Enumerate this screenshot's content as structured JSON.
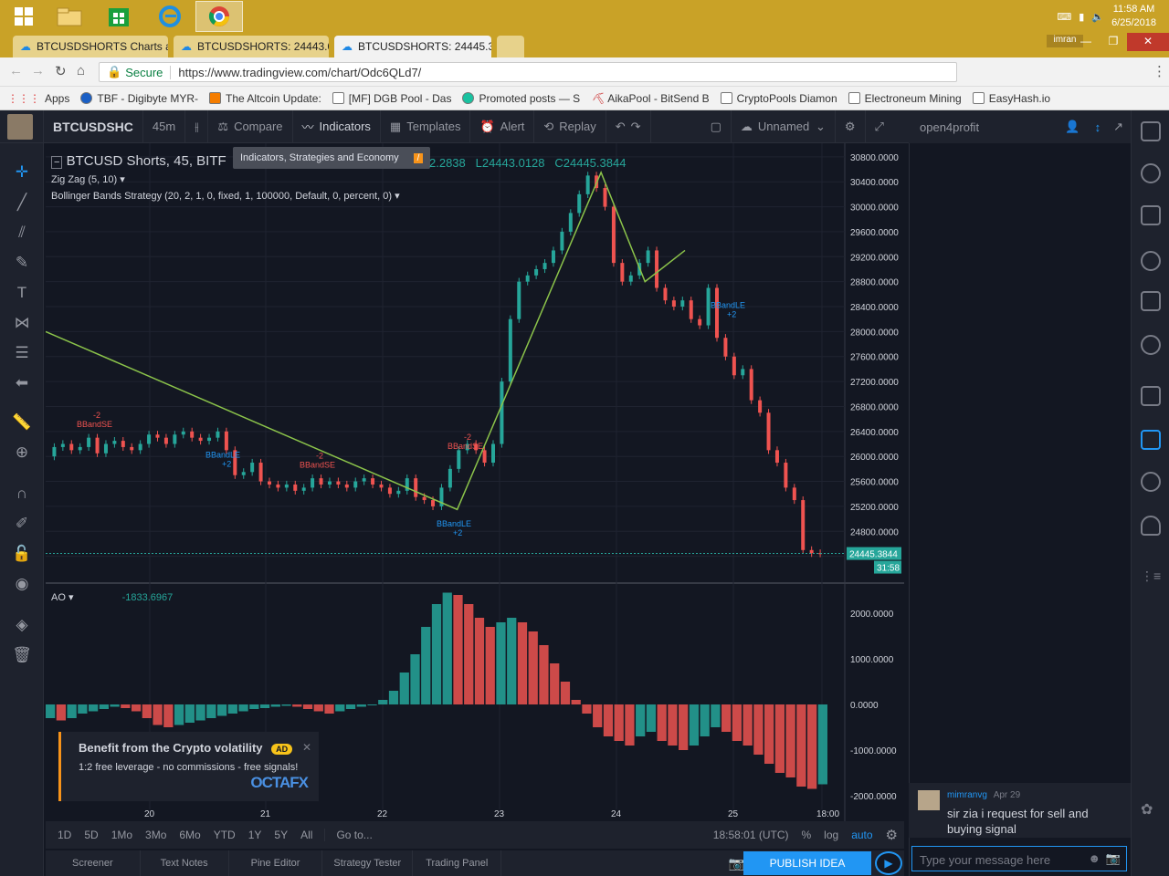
{
  "os": {
    "clock_time": "11:58 AM",
    "clock_date": "6/25/2018",
    "user": "imran"
  },
  "tabs": [
    {
      "label": "BTCUSDSHORTS Charts a",
      "close": "×"
    },
    {
      "label": "BTCUSDSHORTS: 24443.0",
      "close": "×"
    },
    {
      "label": "BTCUSDSHORTS: 24445.3",
      "close": "×"
    }
  ],
  "addressbar": {
    "secure_label": "Secure",
    "url": "https://www.tradingview.com/chart/Odc6QLd7/"
  },
  "bookmarks": [
    "Apps",
    "TBF - Digibyte MYR-",
    "The Altcoin Update:",
    "[MF] DGB Pool - Das",
    "Promoted posts — S",
    "AikaPool - BitSend B",
    "CryptoPools Diamon",
    "Electroneum Mining",
    "EasyHash.io"
  ],
  "toolbar": {
    "symbol": "BTCUSDSHC",
    "interval": "45m",
    "compare": "Compare",
    "indicators": "Indicators",
    "templates": "Templates",
    "alert": "Alert",
    "replay": "Replay",
    "layout_name": "Unnamed"
  },
  "tooltip": {
    "text": "Indicators, Strategies and Economy",
    "shortcut": "/"
  },
  "legend": {
    "title": "BTCUSD Shorts, 45, BITF",
    "ohlc_h": "2.2838",
    "ohlc_l": "L24443.0128",
    "ohlc_c": "C24445.3844",
    "indicator1": "Zig Zag (5, 10)",
    "indicator2": "Bollinger Bands Strategy (20, 2, 1, 0, fixed, 1, 100000, Default, 0, percent, 0)",
    "ao_label": "AO",
    "ao_value": "-1833.6967"
  },
  "price_labels": {
    "current_price": "24445.3844",
    "countdown": "31:58"
  },
  "signal_labels": {
    "bbandse": "BBandSE",
    "bbandle": "BBandLE",
    "minus2": "-2",
    "plus2": "+2"
  },
  "chart_data": {
    "type": "line",
    "title": "BTCUSD Shorts, 45, BITF",
    "x_ticks": [
      "20",
      "21",
      "22",
      "23",
      "24",
      "25",
      "18:00"
    ],
    "price_axis": [
      "30800.0000",
      "30400.0000",
      "30000.0000",
      "29600.0000",
      "29200.0000",
      "28800.0000",
      "28400.0000",
      "28000.0000",
      "27600.0000",
      "27200.0000",
      "26800.0000",
      "26400.0000",
      "26000.0000",
      "25600.0000",
      "25200.0000",
      "24800.0000",
      "24400.0000"
    ],
    "ao_axis": [
      "2000.0000",
      "1000.0000",
      "0.0000",
      "-1000.0000",
      "-2000.0000"
    ],
    "ylim": [
      24000,
      30900
    ],
    "zigzag": [
      {
        "t": 0.0,
        "v": 28000
      },
      {
        "t": 0.515,
        "v": 25150
      },
      {
        "t": 0.695,
        "v": 30550
      },
      {
        "t": 0.75,
        "v": 28800
      },
      {
        "t": 0.8,
        "v": 29300
      }
    ],
    "close_series": [
      26000,
      26150,
      26200,
      26100,
      26150,
      26300,
      26050,
      26200,
      26250,
      26150,
      26100,
      26200,
      26350,
      26300,
      26200,
      26350,
      26400,
      26300,
      26250,
      26300,
      26400,
      26100,
      25700,
      25750,
      25900,
      25600,
      25550,
      25500,
      25550,
      25450,
      25500,
      25650,
      25550,
      25600,
      25550,
      25500,
      25600,
      25650,
      25550,
      25500,
      25400,
      25450,
      25650,
      25350,
      25300,
      25200,
      25500,
      25800,
      26100,
      26200,
      26100,
      25900,
      26200,
      27200,
      28200,
      28800,
      28900,
      29000,
      29100,
      29300,
      29600,
      29900,
      30200,
      30500,
      30300,
      30000,
      29100,
      28800,
      28900,
      29100,
      29300,
      28700,
      28500,
      28400,
      28500,
      28200,
      28100,
      28700,
      27900,
      27600,
      27300,
      27400,
      26900,
      26700,
      26100,
      25900,
      25500,
      25300,
      24500,
      24450,
      24445
    ],
    "ao_series": [
      -300,
      -350,
      -300,
      -200,
      -150,
      -100,
      -50,
      -80,
      -150,
      -300,
      -450,
      -500,
      -450,
      -400,
      -350,
      -300,
      -250,
      -200,
      -150,
      -100,
      -80,
      -50,
      -30,
      -50,
      -100,
      -150,
      -200,
      -150,
      -100,
      -50,
      0,
      100,
      300,
      700,
      1100,
      1700,
      2200,
      2450,
      2400,
      2200,
      1900,
      1700,
      1800,
      1900,
      1800,
      1600,
      1300,
      900,
      500,
      100,
      -200,
      -500,
      -700,
      -800,
      -900,
      -700,
      -600,
      -800,
      -900,
      -1000,
      -900,
      -700,
      -500,
      -600,
      -800,
      -900,
      -1100,
      -1300,
      -1500,
      -1600,
      -1800,
      -1850,
      -1750
    ]
  },
  "timebar": {
    "ranges": [
      "1D",
      "5D",
      "1Mo",
      "3Mo",
      "6Mo",
      "YTD",
      "1Y",
      "5Y",
      "All"
    ],
    "goto": "Go to...",
    "time": "18:58:01 (UTC)",
    "pct": "%",
    "log": "log",
    "auto": "auto"
  },
  "bottom_tabs": [
    "Screener",
    "Text Notes",
    "Pine Editor",
    "Strategy Tester",
    "Trading Panel"
  ],
  "publish": "PUBLISH IDEA",
  "ad": {
    "headline": "Benefit from the Crypto volatility",
    "badge": "AD",
    "body": "1:2 free leverage - no commissions - free signals!",
    "brand": "OCTAFX"
  },
  "chat": {
    "room": "open4profit",
    "message_user": "mimranvg",
    "message_date": "Apr 29",
    "message_text": "sir zia i request for sell and buying signal",
    "input_placeholder": "Type your message here"
  },
  "colors": {
    "up": "#26a69a",
    "down": "#ef5350",
    "zigzag": "#8bc34a",
    "accent": "#2196f3"
  }
}
